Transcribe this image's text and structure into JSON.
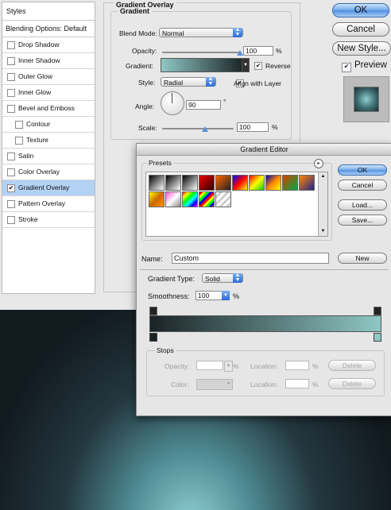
{
  "layer_style": {
    "styles_header": "Styles",
    "blending_options": "Blending Options: Default",
    "items": [
      {
        "label": "Drop Shadow",
        "checked": false,
        "sub": false,
        "selected": false
      },
      {
        "label": "Inner Shadow",
        "checked": false,
        "sub": false,
        "selected": false
      },
      {
        "label": "Outer Glow",
        "checked": false,
        "sub": false,
        "selected": false
      },
      {
        "label": "Inner Glow",
        "checked": false,
        "sub": false,
        "selected": false
      },
      {
        "label": "Bevel and Emboss",
        "checked": false,
        "sub": false,
        "selected": false
      },
      {
        "label": "Contour",
        "checked": false,
        "sub": true,
        "selected": false
      },
      {
        "label": "Texture",
        "checked": false,
        "sub": true,
        "selected": false
      },
      {
        "label": "Satin",
        "checked": false,
        "sub": false,
        "selected": false
      },
      {
        "label": "Color Overlay",
        "checked": false,
        "sub": false,
        "selected": false
      },
      {
        "label": "Gradient Overlay",
        "checked": true,
        "sub": false,
        "selected": true
      },
      {
        "label": "Pattern Overlay",
        "checked": false,
        "sub": false,
        "selected": false
      },
      {
        "label": "Stroke",
        "checked": false,
        "sub": false,
        "selected": false
      }
    ],
    "panel_title": "Gradient Overlay",
    "section_title": "Gradient",
    "blend_mode_label": "Blend Mode:",
    "blend_mode_value": "Normal",
    "opacity_label": "Opacity:",
    "opacity_value": "100",
    "percent": "%",
    "gradient_label": "Gradient:",
    "reverse_label": "Reverse",
    "reverse_checked": true,
    "style_label": "Style:",
    "style_value": "Radial",
    "align_label": "Align with Layer",
    "align_checked": true,
    "angle_label": "Angle:",
    "angle_value": "90",
    "degree": "°",
    "scale_label": "Scale:",
    "scale_value": "100",
    "ok_label": "OK",
    "cancel_label": "Cancel",
    "new_style_label": "New Style...",
    "preview_label": "Preview",
    "preview_checked": true
  },
  "gradient_editor": {
    "title": "Gradient Editor",
    "presets_label": "Presets",
    "ok_label": "OK",
    "cancel_label": "Cancel",
    "load_label": "Load...",
    "save_label": "Save...",
    "name_label": "Name:",
    "name_value": "Custom",
    "new_label": "New",
    "gradient_type_label": "Gradient Type:",
    "gradient_type_value": "Solid",
    "smoothness_label": "Smoothness:",
    "smoothness_value": "100",
    "percent": "%",
    "stops_label": "Stops",
    "opacity_label": "Opacity:",
    "location_label": "Location:",
    "delete_label": "Delete",
    "color_label": "Color:",
    "gradient_start": "#1a2226",
    "gradient_end": "#8fc8c4"
  }
}
